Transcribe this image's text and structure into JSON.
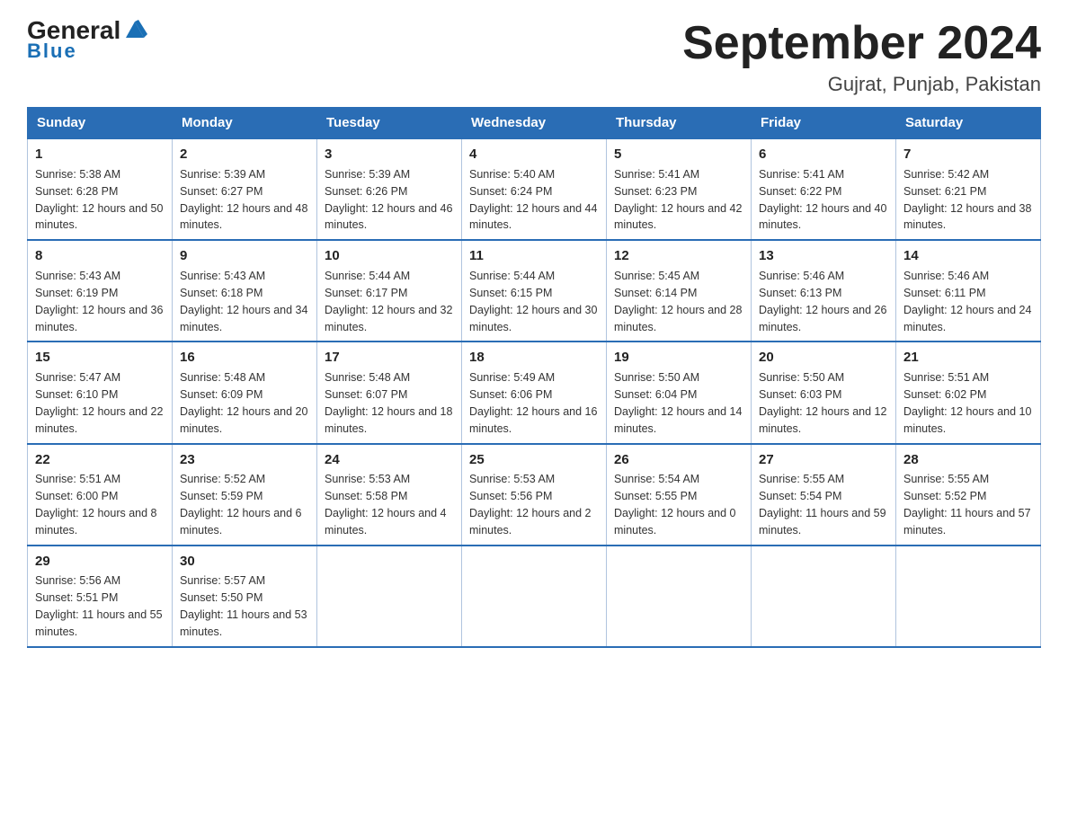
{
  "header": {
    "logo_general": "General",
    "logo_blue": "Blue",
    "title": "September 2024",
    "subtitle": "Gujrat, Punjab, Pakistan"
  },
  "weekdays": [
    "Sunday",
    "Monday",
    "Tuesday",
    "Wednesday",
    "Thursday",
    "Friday",
    "Saturday"
  ],
  "weeks": [
    [
      {
        "day": "1",
        "sunrise": "5:38 AM",
        "sunset": "6:28 PM",
        "daylight": "12 hours and 50 minutes."
      },
      {
        "day": "2",
        "sunrise": "5:39 AM",
        "sunset": "6:27 PM",
        "daylight": "12 hours and 48 minutes."
      },
      {
        "day": "3",
        "sunrise": "5:39 AM",
        "sunset": "6:26 PM",
        "daylight": "12 hours and 46 minutes."
      },
      {
        "day": "4",
        "sunrise": "5:40 AM",
        "sunset": "6:24 PM",
        "daylight": "12 hours and 44 minutes."
      },
      {
        "day": "5",
        "sunrise": "5:41 AM",
        "sunset": "6:23 PM",
        "daylight": "12 hours and 42 minutes."
      },
      {
        "day": "6",
        "sunrise": "5:41 AM",
        "sunset": "6:22 PM",
        "daylight": "12 hours and 40 minutes."
      },
      {
        "day": "7",
        "sunrise": "5:42 AM",
        "sunset": "6:21 PM",
        "daylight": "12 hours and 38 minutes."
      }
    ],
    [
      {
        "day": "8",
        "sunrise": "5:43 AM",
        "sunset": "6:19 PM",
        "daylight": "12 hours and 36 minutes."
      },
      {
        "day": "9",
        "sunrise": "5:43 AM",
        "sunset": "6:18 PM",
        "daylight": "12 hours and 34 minutes."
      },
      {
        "day": "10",
        "sunrise": "5:44 AM",
        "sunset": "6:17 PM",
        "daylight": "12 hours and 32 minutes."
      },
      {
        "day": "11",
        "sunrise": "5:44 AM",
        "sunset": "6:15 PM",
        "daylight": "12 hours and 30 minutes."
      },
      {
        "day": "12",
        "sunrise": "5:45 AM",
        "sunset": "6:14 PM",
        "daylight": "12 hours and 28 minutes."
      },
      {
        "day": "13",
        "sunrise": "5:46 AM",
        "sunset": "6:13 PM",
        "daylight": "12 hours and 26 minutes."
      },
      {
        "day": "14",
        "sunrise": "5:46 AM",
        "sunset": "6:11 PM",
        "daylight": "12 hours and 24 minutes."
      }
    ],
    [
      {
        "day": "15",
        "sunrise": "5:47 AM",
        "sunset": "6:10 PM",
        "daylight": "12 hours and 22 minutes."
      },
      {
        "day": "16",
        "sunrise": "5:48 AM",
        "sunset": "6:09 PM",
        "daylight": "12 hours and 20 minutes."
      },
      {
        "day": "17",
        "sunrise": "5:48 AM",
        "sunset": "6:07 PM",
        "daylight": "12 hours and 18 minutes."
      },
      {
        "day": "18",
        "sunrise": "5:49 AM",
        "sunset": "6:06 PM",
        "daylight": "12 hours and 16 minutes."
      },
      {
        "day": "19",
        "sunrise": "5:50 AM",
        "sunset": "6:04 PM",
        "daylight": "12 hours and 14 minutes."
      },
      {
        "day": "20",
        "sunrise": "5:50 AM",
        "sunset": "6:03 PM",
        "daylight": "12 hours and 12 minutes."
      },
      {
        "day": "21",
        "sunrise": "5:51 AM",
        "sunset": "6:02 PM",
        "daylight": "12 hours and 10 minutes."
      }
    ],
    [
      {
        "day": "22",
        "sunrise": "5:51 AM",
        "sunset": "6:00 PM",
        "daylight": "12 hours and 8 minutes."
      },
      {
        "day": "23",
        "sunrise": "5:52 AM",
        "sunset": "5:59 PM",
        "daylight": "12 hours and 6 minutes."
      },
      {
        "day": "24",
        "sunrise": "5:53 AM",
        "sunset": "5:58 PM",
        "daylight": "12 hours and 4 minutes."
      },
      {
        "day": "25",
        "sunrise": "5:53 AM",
        "sunset": "5:56 PM",
        "daylight": "12 hours and 2 minutes."
      },
      {
        "day": "26",
        "sunrise": "5:54 AM",
        "sunset": "5:55 PM",
        "daylight": "12 hours and 0 minutes."
      },
      {
        "day": "27",
        "sunrise": "5:55 AM",
        "sunset": "5:54 PM",
        "daylight": "11 hours and 59 minutes."
      },
      {
        "day": "28",
        "sunrise": "5:55 AM",
        "sunset": "5:52 PM",
        "daylight": "11 hours and 57 minutes."
      }
    ],
    [
      {
        "day": "29",
        "sunrise": "5:56 AM",
        "sunset": "5:51 PM",
        "daylight": "11 hours and 55 minutes."
      },
      {
        "day": "30",
        "sunrise": "5:57 AM",
        "sunset": "5:50 PM",
        "daylight": "11 hours and 53 minutes."
      },
      null,
      null,
      null,
      null,
      null
    ]
  ]
}
